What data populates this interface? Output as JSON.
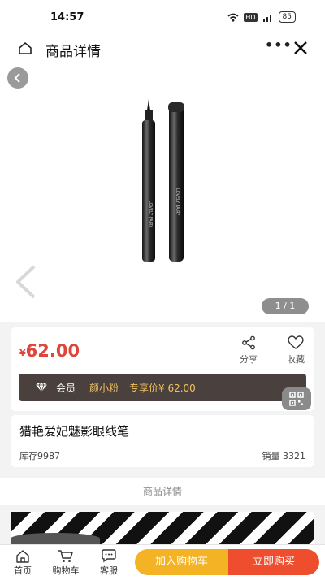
{
  "status_bar": {
    "time": "14:57",
    "hd": "HD",
    "battery": "85"
  },
  "navbar": {
    "title": "商品详情"
  },
  "gallery": {
    "pager": "1 / 1"
  },
  "price": {
    "currency": "¥",
    "amount": "62.00"
  },
  "actions": {
    "share": "分享",
    "favorite": "收藏"
  },
  "vip": {
    "label": "会员",
    "level": "颜小粉",
    "member_price": "专享价¥ 62.00"
  },
  "product": {
    "name": "猎艳爱妃魅影眼线笔",
    "stock": "库存9987",
    "sales": "销量 3321"
  },
  "section": {
    "details_title": "商品详情"
  },
  "bottom_bar": {
    "tabs": [
      {
        "label": "首页",
        "icon": "home-icon"
      },
      {
        "label": "购物车",
        "icon": "cart-icon"
      },
      {
        "label": "客服",
        "icon": "chat-icon"
      }
    ],
    "add_to_cart": "加入购物车",
    "buy_now": "立即购买"
  }
}
